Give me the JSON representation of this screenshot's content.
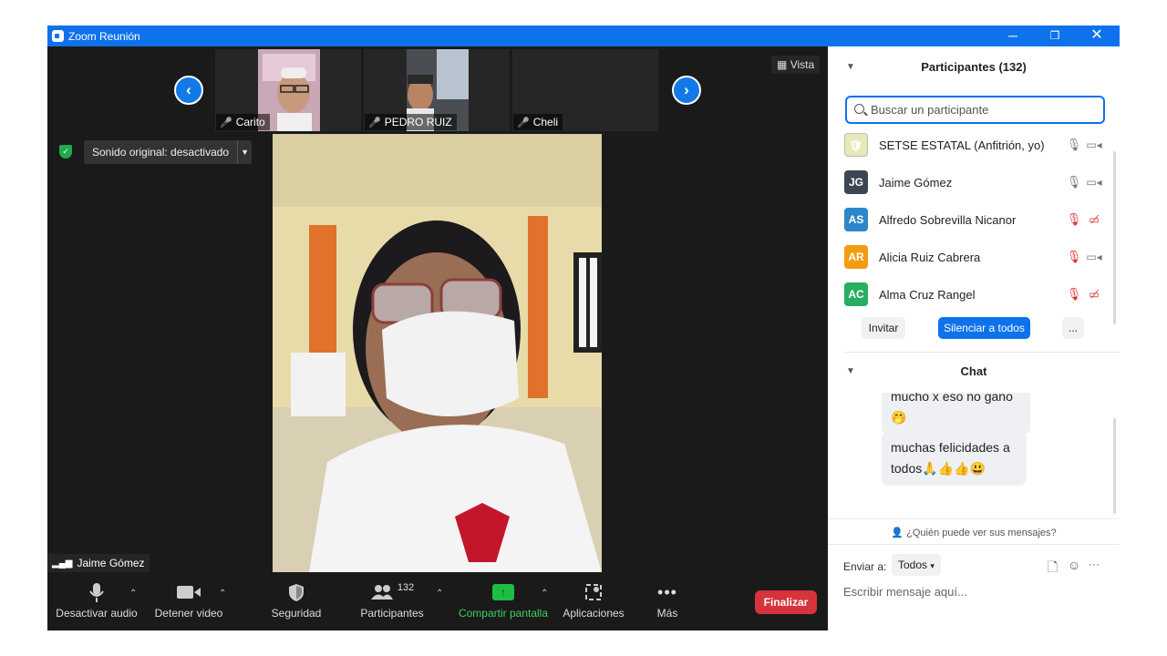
{
  "window": {
    "title": "Zoom Reunión"
  },
  "gallery": {
    "thumbs": [
      {
        "name": "Carito"
      },
      {
        "name": "PEDRO RUIZ"
      },
      {
        "name": "Cheli"
      }
    ],
    "view_label": "Vista"
  },
  "audio": {
    "original_sound": "Sonido original: desactivado"
  },
  "speaker": {
    "name": "Jaime Gómez"
  },
  "toolbar": {
    "mute": "Desactivar audio",
    "video": "Detener video",
    "security": "Seguridad",
    "participants": "Participantes",
    "participants_count": "132",
    "share": "Compartir pantalla",
    "apps": "Aplicaciones",
    "more": "Más",
    "end": "Finalizar"
  },
  "participants_panel": {
    "title": "Participantes (132)",
    "search_placeholder": "Buscar un participante",
    "list": [
      {
        "initials": "",
        "name": "SETSE ESTATAL (Anfitrión, yo)",
        "color": "#c9d94a",
        "mic_muted": false,
        "cam_off": false
      },
      {
        "initials": "JG",
        "name": "Jaime Gómez",
        "color": "#3d4654",
        "mic_muted": false,
        "cam_off": false
      },
      {
        "initials": "AS",
        "name": "Alfredo Sobrevilla Nicanor",
        "color": "#2e86c9",
        "mic_muted": true,
        "cam_off": true
      },
      {
        "initials": "AR",
        "name": "Alicia Ruiz Cabrera",
        "color": "#f39c12",
        "mic_muted": true,
        "cam_off": false
      },
      {
        "initials": "AC",
        "name": "Alma Cruz Rangel",
        "color": "#27ae60",
        "mic_muted": true,
        "cam_off": true
      }
    ],
    "invite": "Invitar",
    "mute_all": "Silenciar a todos",
    "more": "..."
  },
  "chat": {
    "title": "Chat",
    "messages": [
      {
        "text": "mucho x eso no gano 🤭"
      },
      {
        "text": "muchas felicidades a todos🙏👍👍😃"
      }
    ],
    "who_can_see": "¿Quién puede ver sus mensajes?",
    "send_to_label": "Enviar a:",
    "send_to_value": "Todos",
    "input_placeholder": "Escribir mensaje aquí..."
  }
}
